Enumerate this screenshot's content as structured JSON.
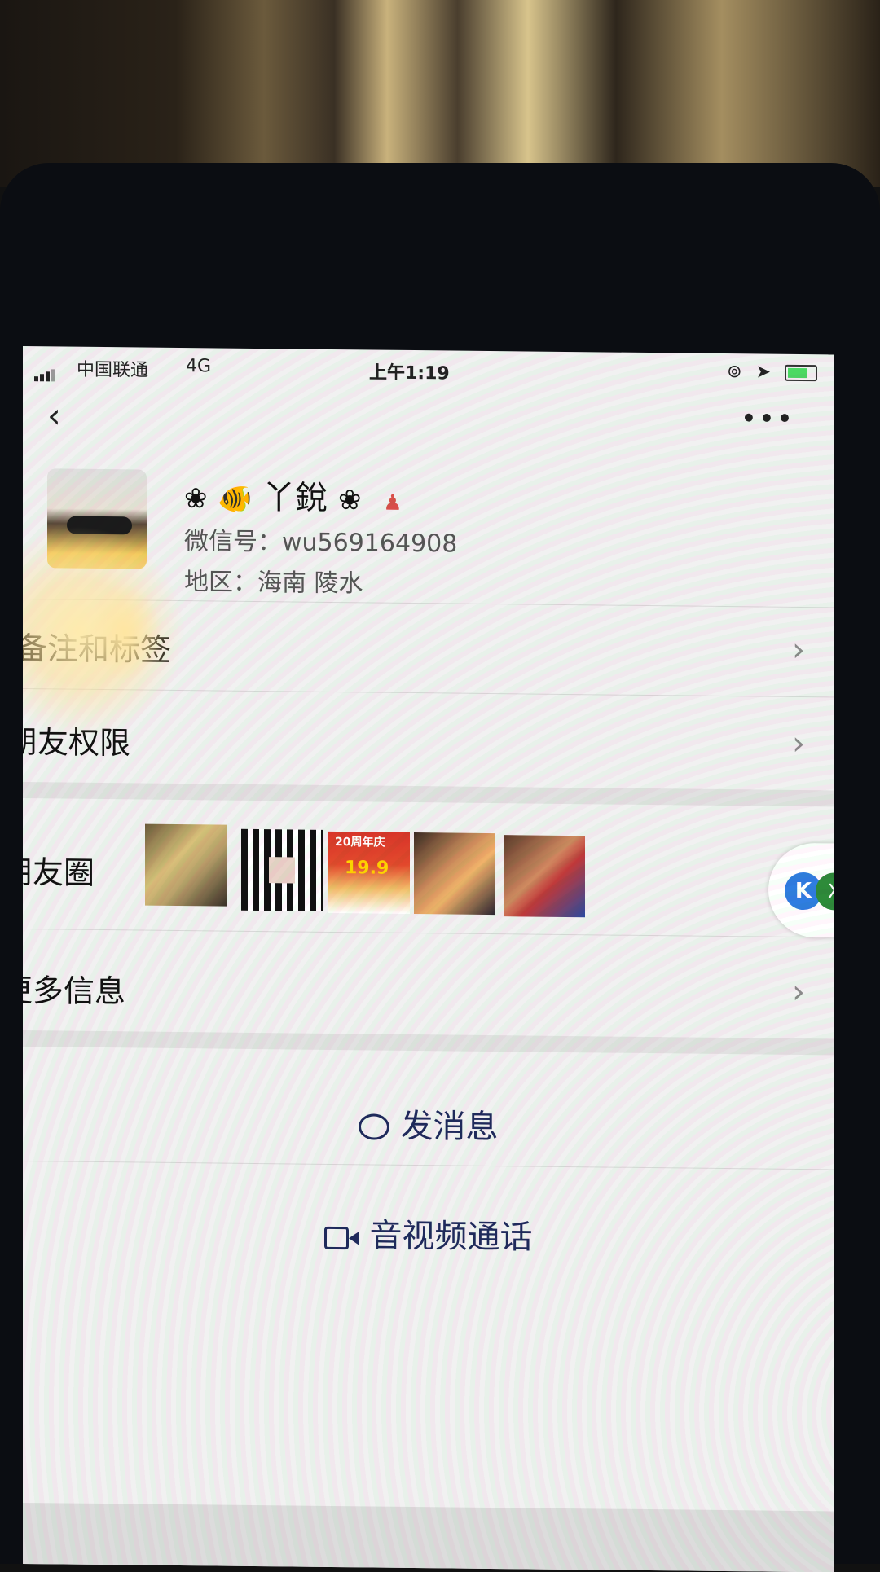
{
  "status_bar": {
    "carrier": "中国联通",
    "network": "4G",
    "time": "上午1:19",
    "icons": [
      "orientation-lock-icon",
      "location-icon",
      "battery-charging-icon"
    ]
  },
  "nav": {
    "back_icon": "‹",
    "more_icon": "•••"
  },
  "profile": {
    "name_prefix": "❀",
    "name_fish": "🐠",
    "name_text": "丫銳",
    "name_suffix": "❀",
    "badge_icon": "♟",
    "wechat_id": "微信号：wu569164908",
    "region": "地区：海南 陵水"
  },
  "rows": {
    "remarks_tags": "备注和标签",
    "friend_permissions": "朋友权限",
    "moments": "朋友圈",
    "more_info": "更多信息"
  },
  "moments_thumbs": {
    "thumb3_title": "20周年庆",
    "thumb3_price": "19.9"
  },
  "float_widget": {
    "k_label": "K",
    "x_label": "X"
  },
  "actions": {
    "send_message": "发消息",
    "video_call": "音视频通话"
  },
  "colors": {
    "action_text": "#1f2a5c",
    "screen_bg": "#f1f1f1",
    "chevron": "#8a8a8a"
  }
}
